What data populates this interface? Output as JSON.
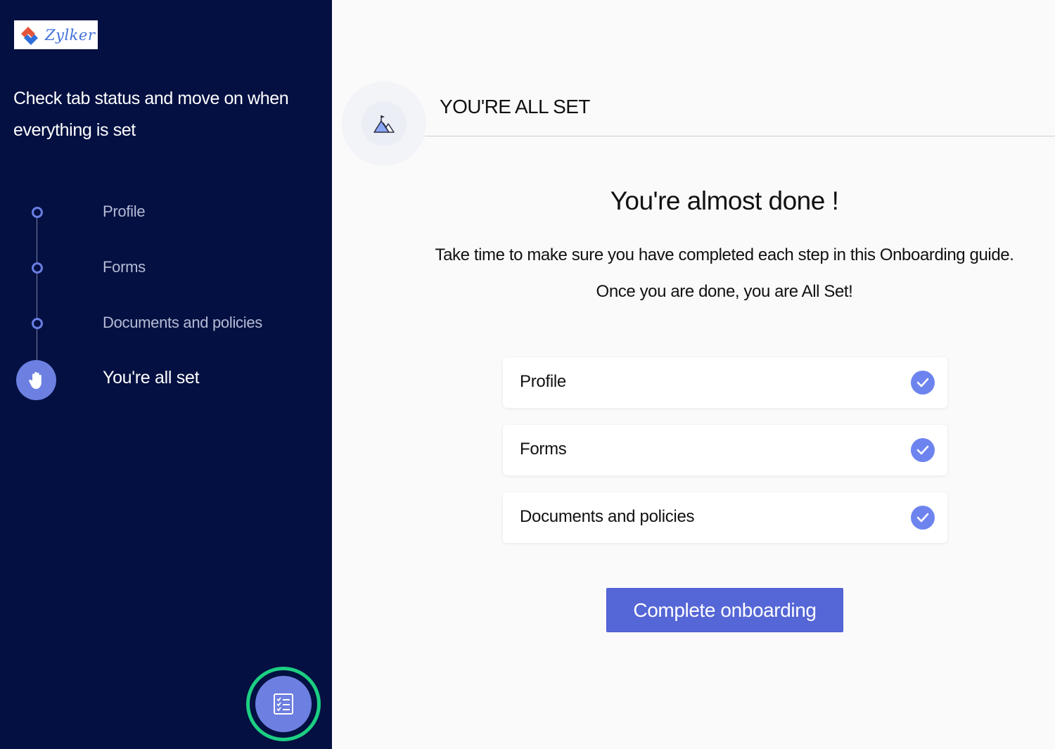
{
  "brand": {
    "name": "Zylker",
    "logo_icon": "zylker-logo-icon"
  },
  "sidebar": {
    "title": "Check tab status and move on when everything is set",
    "steps": [
      {
        "label": "Profile",
        "state": "complete",
        "icon": "step-dot-icon"
      },
      {
        "label": "Forms",
        "state": "complete",
        "icon": "step-dot-icon"
      },
      {
        "label": "Documents and policies",
        "state": "complete",
        "icon": "step-dot-icon"
      },
      {
        "label": "You're all set",
        "state": "active",
        "icon": "hand-icon"
      }
    ],
    "fab_icon": "checklist-icon"
  },
  "main": {
    "header_title": "YOU'RE ALL SET",
    "header_icon": "mountain-flag-icon",
    "headline": "You're almost done !",
    "description_1": "Take time to make sure you have completed each step in this Onboarding guide.",
    "description_2": "Once you are done, you are All Set!",
    "checklist": [
      {
        "label": "Profile",
        "status": "done",
        "icon": "check-circle-icon"
      },
      {
        "label": "Forms",
        "status": "done",
        "icon": "check-circle-icon"
      },
      {
        "label": "Documents and policies",
        "status": "done",
        "icon": "check-circle-icon"
      }
    ],
    "complete_button": "Complete onboarding"
  },
  "colors": {
    "sidebar_bg": "#031041",
    "accent": "#6d7fe0",
    "button": "#5566d6",
    "check": "#6d84ef",
    "fab_ring": "#1ccf82"
  }
}
